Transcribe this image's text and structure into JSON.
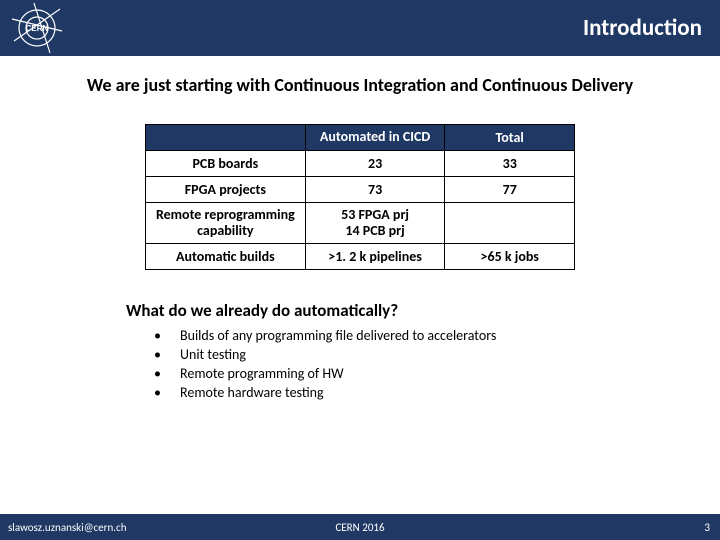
{
  "header": {
    "title": "Introduction",
    "logo_name": "cern-logo"
  },
  "intro": "We are just starting with Continuous Integration and Continuous Delivery",
  "table": {
    "headers": [
      "",
      "Automated in CICD",
      "Total"
    ],
    "rows": [
      {
        "label": "PCB boards",
        "cicd": "23",
        "total": "33"
      },
      {
        "label": "FPGA projects",
        "cicd": "73",
        "total": "77"
      },
      {
        "label": "Remote reprogramming capability",
        "cicd": "53 FPGA prj\n14 PCB prj",
        "total": ""
      },
      {
        "label": "Automatic builds",
        "cicd": ">1. 2 k pipelines",
        "total": ">65 k jobs"
      }
    ]
  },
  "subhead": "What do we already do automatically?",
  "bullets": [
    "Builds of any programming file delivered to accelerators",
    "Unit testing",
    "Remote programming of HW",
    "Remote hardware testing"
  ],
  "footer": {
    "email": "slawosz.uznanski@cern.ch",
    "center": "CERN 2016",
    "page": "3"
  },
  "chart_data": {
    "type": "table",
    "columns": [
      "",
      "Automated in CICD",
      "Total"
    ],
    "rows": [
      [
        "PCB boards",
        "23",
        "33"
      ],
      [
        "FPGA projects",
        "73",
        "77"
      ],
      [
        "Remote reprogramming capability",
        "53 FPGA prj / 14 PCB prj",
        ""
      ],
      [
        "Automatic builds",
        ">1.2 k pipelines",
        ">65 k jobs"
      ]
    ],
    "title": "Introduction"
  }
}
